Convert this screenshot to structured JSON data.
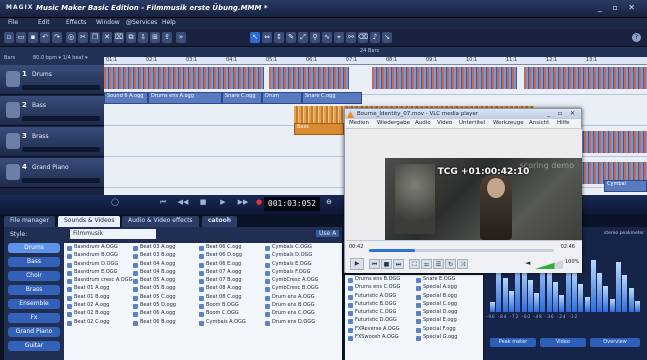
{
  "app": {
    "logo": "MAGIX",
    "title": "Music Maker Basic Edition - Filmmusik erste Übung.MMM *",
    "window_controls": "_ ▫ ✕"
  },
  "menu": [
    "File",
    "Edit",
    "Effects",
    "Window",
    "@Services",
    "Help"
  ],
  "ruler": {
    "bars_label": "Bars",
    "tempo": "80.0 bpm ▾ 1/4 beat ▾",
    "bars_count": "24 Bars",
    "marks": [
      "01:1",
      "02:1",
      "03:1",
      "04:1",
      "05:1",
      "06:1",
      "07:1",
      "08:1",
      "09:1",
      "10:1",
      "11:1",
      "12:1",
      "13:1"
    ]
  },
  "tracks": [
    {
      "num": "1",
      "name": "Drums"
    },
    {
      "num": "2",
      "name": "Bass"
    },
    {
      "num": "3",
      "name": "Brass"
    },
    {
      "num": "4",
      "name": "Grand Piano"
    }
  ],
  "arrangement": {
    "objects": [
      "Sound 6 A.ogg",
      "Drums ens A.ogg",
      "Snare C.ogg",
      "Drum",
      "Snare C.ogg",
      "Bass",
      "Cymbal"
    ]
  },
  "transport": {
    "timecode": "001:03:052"
  },
  "browser": {
    "tabs": [
      "File manager",
      "Sounds & Videos",
      "Audio & Video effects",
      "catooh"
    ],
    "style_label": "Style:",
    "style_value": "Filmmusik",
    "use_label": "Use A",
    "categories": [
      "Drums",
      "Bass",
      "Choir",
      "Brass",
      "Ensemble",
      "Fx",
      "Grand Piano",
      "Guitar"
    ],
    "columns": [
      [
        "Basndrum A.OGG",
        "Basndrum B.OGG",
        "Basndrum D.OGG",
        "Basndrum E.OGG",
        "Basndrum cresc A.OGG",
        "Beat 01 A.ogg",
        "Beat 01 B.ogg",
        "Beat 02 A.ogg",
        "Beat 02 B.ogg",
        "Beat 02 C.ogg"
      ],
      [
        "Beat 03 A.ogg",
        "Beat 03 B.ogg",
        "Beat 04 A.ogg",
        "Beat 04 B.ogg",
        "Beat 05 A.ogg",
        "Beat 05 B.ogg",
        "Beat 05 C.ogg",
        "Beat 05 D.ogg",
        "Beat 06 A.ogg",
        "Beat 06 B.ogg"
      ],
      [
        "Beat 06 C.ogg",
        "Beat 06 D.ogg",
        "Beat 06 E.ogg",
        "Beat 07 A.ogg",
        "Beat 07 B.ogg",
        "Beat 08 A.ogg",
        "Beat 08 C.ogg",
        "Boom B.OGG",
        "Boom C.OGG",
        "Cymbals A.OGG"
      ],
      [
        "Cymbals C.OGG",
        "Cymbals D.OGG",
        "Cymbals E.OGG",
        "Cymbals F.OGG",
        "CymbCresc A.OGG",
        "CymbCresc B.OGG",
        "Drum ens A.OGG",
        "Drum ens B.OGG",
        "Drum ens C.OGG",
        "Drum ens D.OGG"
      ],
      [
        "Drums ens B.OGG",
        "Drums ens C.OGG",
        "Futuristic A.OGG",
        "Futuristic B.OGG",
        "Futuristic C.OGG",
        "Futuristic D.OGG",
        "FXReverse A.OGG",
        "FXSwoosh A.OGG"
      ],
      [
        "Snare E.OGG",
        "Special A.ogg",
        "Special B.ogg",
        "Special C.ogg",
        "Special D.ogg",
        "Special E.ogg",
        "Special F.ogg",
        "Special G.ogg"
      ]
    ]
  },
  "vlc": {
    "title": "Bourne_Identity_07.mov - VLC media player",
    "menu": [
      "Medien",
      "Wiedergabe",
      "Audio",
      "Video",
      "Untertitel",
      "Werkzeuge",
      "Ansicht",
      "Hilfe"
    ],
    "watermark": "scoring demo",
    "overlay_timecode": "TCG +01:00:42:10",
    "time_current": "00:42",
    "time_total": "02:46",
    "progress_fraction": 0.25,
    "volume_percent": "100%"
  },
  "mixer": {
    "title": "stereo peakmeter",
    "scale": "-96 -84 -72 -60 -48 -36 -24 -12",
    "buttons": [
      "Peak meter",
      "Video",
      "Overview"
    ]
  }
}
